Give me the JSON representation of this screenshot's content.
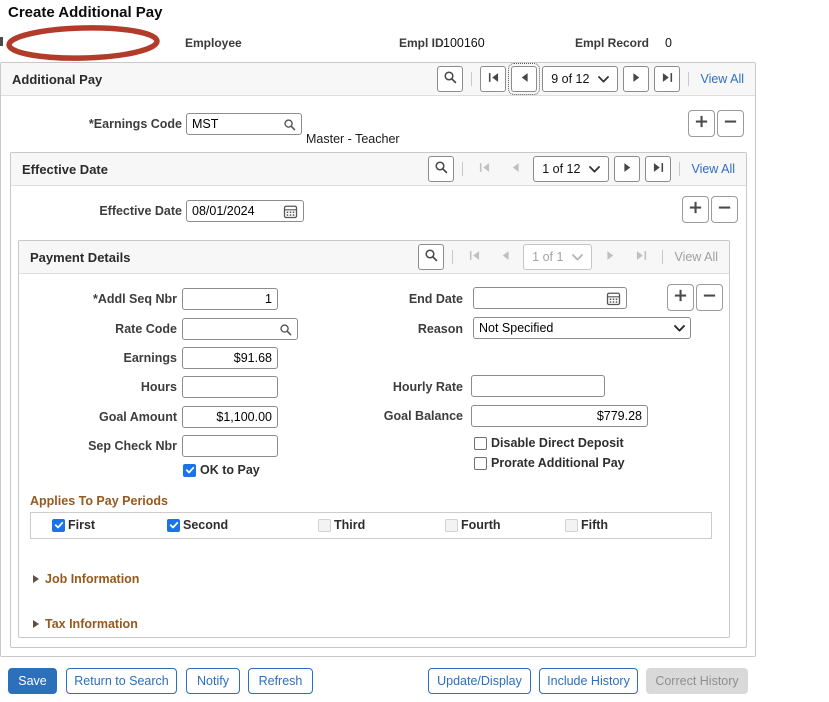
{
  "page": {
    "title": "Create Additional Pay"
  },
  "employee_header": {
    "employee_label": "Employee",
    "empl_id_label": "Empl ID",
    "empl_id_value": "100160",
    "empl_record_label": "Empl Record",
    "empl_record_value": "0"
  },
  "additional_pay": {
    "title": "Additional Pay",
    "nav": {
      "position": "9 of 12",
      "view_all": "View All"
    },
    "earnings_code": {
      "label": "*Earnings Code",
      "value": "MST",
      "description": "Master - Teacher"
    }
  },
  "effective_date_section": {
    "title": "Effective Date",
    "nav": {
      "position": "1 of 12",
      "view_all": "View All"
    },
    "field": {
      "label": "Effective Date",
      "value": "08/01/2024"
    }
  },
  "payment_details": {
    "title": "Payment Details",
    "nav": {
      "position": "1 of 1",
      "view_all": "View All"
    },
    "fields": {
      "addl_seq_nbr": {
        "label": "*Addl Seq Nbr",
        "value": "1"
      },
      "rate_code": {
        "label": "Rate Code",
        "value": ""
      },
      "earnings": {
        "label": "Earnings",
        "value": "$91.68"
      },
      "hours": {
        "label": "Hours",
        "value": ""
      },
      "goal_amount": {
        "label": "Goal Amount",
        "value": "$1,100.00"
      },
      "sep_check_nbr": {
        "label": "Sep Check Nbr",
        "value": ""
      },
      "end_date": {
        "label": "End Date",
        "value": ""
      },
      "reason": {
        "label": "Reason",
        "value": "Not Specified"
      },
      "hourly_rate": {
        "label": "Hourly Rate",
        "value": ""
      },
      "goal_balance": {
        "label": "Goal Balance",
        "value": "$779.28"
      }
    },
    "checkboxes": {
      "ok_to_pay": {
        "label": "OK to Pay",
        "checked": true
      },
      "disable_direct_deposit": {
        "label": "Disable Direct Deposit",
        "checked": false
      },
      "prorate_additional_pay": {
        "label": "Prorate Additional Pay",
        "checked": false
      }
    },
    "pay_periods": {
      "title": "Applies To Pay Periods",
      "options": [
        {
          "label": "First",
          "checked": true,
          "disabled": false
        },
        {
          "label": "Second",
          "checked": true,
          "disabled": false
        },
        {
          "label": "Third",
          "checked": false,
          "disabled": true
        },
        {
          "label": "Fourth",
          "checked": false,
          "disabled": true
        },
        {
          "label": "Fifth",
          "checked": false,
          "disabled": true
        }
      ]
    },
    "collapsed_sections": [
      {
        "label": "Job Information"
      },
      {
        "label": "Tax Information"
      }
    ]
  },
  "toolbar": {
    "save": "Save",
    "return_to_search": "Return to Search",
    "notify": "Notify",
    "refresh": "Refresh",
    "update_display": "Update/Display",
    "include_history": "Include History",
    "correct_history": "Correct History"
  },
  "colors": {
    "accent_blue": "#2C6FBB",
    "link_blue": "#2F6EC6",
    "section_label_brown": "#96591E",
    "checkbox_blue": "#1A73E8",
    "group_header_bg": "#F7F7F7",
    "group_border": "#C8C8C8",
    "redaction_red": "#B23B2A",
    "disabled_text": "#A0A0A0"
  },
  "icons": {
    "search-icon": "magnifier",
    "calendar-icon": "calendar-grid",
    "add-row-icon": "plus",
    "delete-row-icon": "minus",
    "first-row-icon": "bar+left-triangle",
    "previous-row-icon": "left-triangle",
    "next-row-icon": "right-triangle",
    "last-row-icon": "right-triangle+bar",
    "chevron-down-icon": "v-chevron",
    "collapsed-section-icon": "right-triangle",
    "checkmark-icon": "check"
  }
}
